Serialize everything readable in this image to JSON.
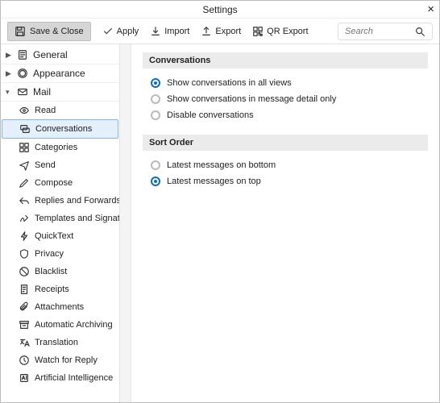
{
  "title": "Settings",
  "toolbar": {
    "save": "Save & Close",
    "apply": "Apply",
    "import": "Import",
    "export": "Export",
    "qr_export": "QR Export",
    "search_placeholder": "Search"
  },
  "sidebar": {
    "top": [
      {
        "label": "General",
        "expanded": false
      },
      {
        "label": "Appearance",
        "expanded": false
      },
      {
        "label": "Mail",
        "expanded": true
      }
    ],
    "mail_items": [
      "Read",
      "Conversations",
      "Categories",
      "Send",
      "Compose",
      "Replies and Forwards",
      "Templates and Signatures",
      "QuickText",
      "Privacy",
      "Blacklist",
      "Receipts",
      "Attachments",
      "Automatic Archiving",
      "Translation",
      "Watch for Reply",
      "Artificial Intelligence"
    ],
    "selected_mail_item": 1
  },
  "sections": {
    "conversations": {
      "header": "Conversations",
      "options": [
        "Show conversations in all views",
        "Show conversations in message detail only",
        "Disable conversations"
      ],
      "selected": 0
    },
    "sort_order": {
      "header": "Sort Order",
      "options": [
        "Latest messages on bottom",
        "Latest messages on top"
      ],
      "selected": 1
    }
  }
}
